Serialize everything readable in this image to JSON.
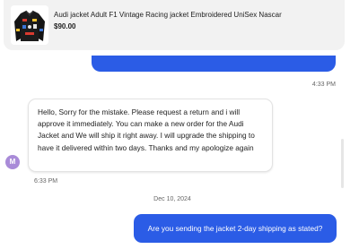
{
  "product": {
    "title": "Audi jacket Adult F1 Vintage Racing jacket Embroidered UniSex Nascar",
    "price": "$90.00"
  },
  "messages": [
    {
      "id": "incoming-1",
      "text": "Hello, Sorry for the mistake. Please request a return and i will approve it immediately. You can make a new order for the Audi Jacket and We will ship it right away. I will upgrade the shipping to have it delivered within two days. Thanks and my apologize again",
      "time": "6:33 PM",
      "sender_initial": "M"
    },
    {
      "id": "outgoing-2",
      "text": "Are you sending the jacket 2-day shipping as stated?"
    }
  ],
  "previous_message_time": "4:33 PM",
  "date_divider": "Dec 10, 2024",
  "colors": {
    "accent": "#2b5ce6",
    "avatar": "#a98bd8",
    "card_bg": "#f2f2f2"
  }
}
